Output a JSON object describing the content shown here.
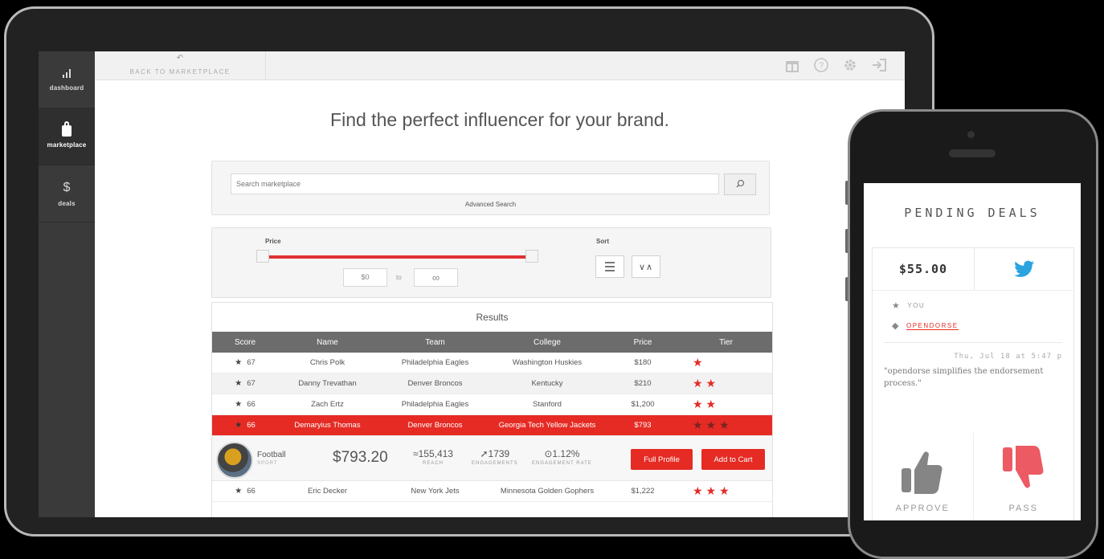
{
  "sidebar": {
    "items": [
      {
        "label": "dashboard"
      },
      {
        "label": "marketplace"
      },
      {
        "label": "deals"
      }
    ]
  },
  "topbar": {
    "back_label": "BACK TO MARKETPLACE",
    "icons": [
      "gift-icon",
      "help-icon",
      "settings-icon",
      "logout-icon"
    ]
  },
  "headline": "Find the perfect influencer for your brand.",
  "search": {
    "placeholder": "Search marketplace",
    "advanced_label": "Advanced Search"
  },
  "filters": {
    "price_label": "Price",
    "sort_label": "Sort",
    "min_value": "$0",
    "to_label": "to",
    "max_value": "∞"
  },
  "results": {
    "title": "Results",
    "columns": [
      "Score",
      "Name",
      "Team",
      "College",
      "Price",
      "Tier"
    ],
    "rows": [
      {
        "score": "67",
        "name": "Chris Polk",
        "team": "Philadelphia Eagles",
        "college": "Washington Huskies",
        "price": "$180",
        "tier": "★"
      },
      {
        "score": "67",
        "name": "Danny Trevathan",
        "team": "Denver Broncos",
        "college": "Kentucky",
        "price": "$210",
        "tier": "★★"
      },
      {
        "score": "66",
        "name": "Zach Ertz",
        "team": "Philadelphia Eagles",
        "college": "Stanford",
        "price": "$1,200",
        "tier": "★★"
      },
      {
        "score": "66",
        "name": "Demaryius Thomas",
        "team": "Denver Broncos",
        "college": "Georgia Tech Yellow Jackets",
        "price": "$793",
        "tier": "★★★"
      }
    ],
    "detail": {
      "sport": "Football",
      "sport_caption": "SPORT",
      "price": "$793.20",
      "reach": "155,413",
      "reach_caption": "REACH",
      "engagements": "1739",
      "engagements_caption": "ENGAGEMENTS",
      "engagement_rate": "1.12%",
      "engagement_rate_caption": "ENGAGEMENT RATE",
      "full_profile_label": "Full Profile",
      "add_to_cart_label": "Add to Cart"
    },
    "partial_row": {
      "score": "66",
      "name": "Eric Decker",
      "team": "New York Jets",
      "college": "Minnesota Golden Gophers",
      "price": "$1,222",
      "tier": "★★★"
    }
  },
  "phone": {
    "title": "PENDING DEALS",
    "deal_amount": "$55.00",
    "you_label": "YOU",
    "brand_label": "OPENDORSE",
    "timestamp": "Thu, Jul 18 at 5:47 p",
    "quote": "\"opendorse simplifies the endorsement process.\"",
    "approve_label": "APPROVE",
    "pass_label": "PASS"
  },
  "colors": {
    "accent": "#e52b24",
    "twitter": "#2aa3e0",
    "sidebar": "#3a3a3a",
    "pass": "#ec5b64"
  }
}
